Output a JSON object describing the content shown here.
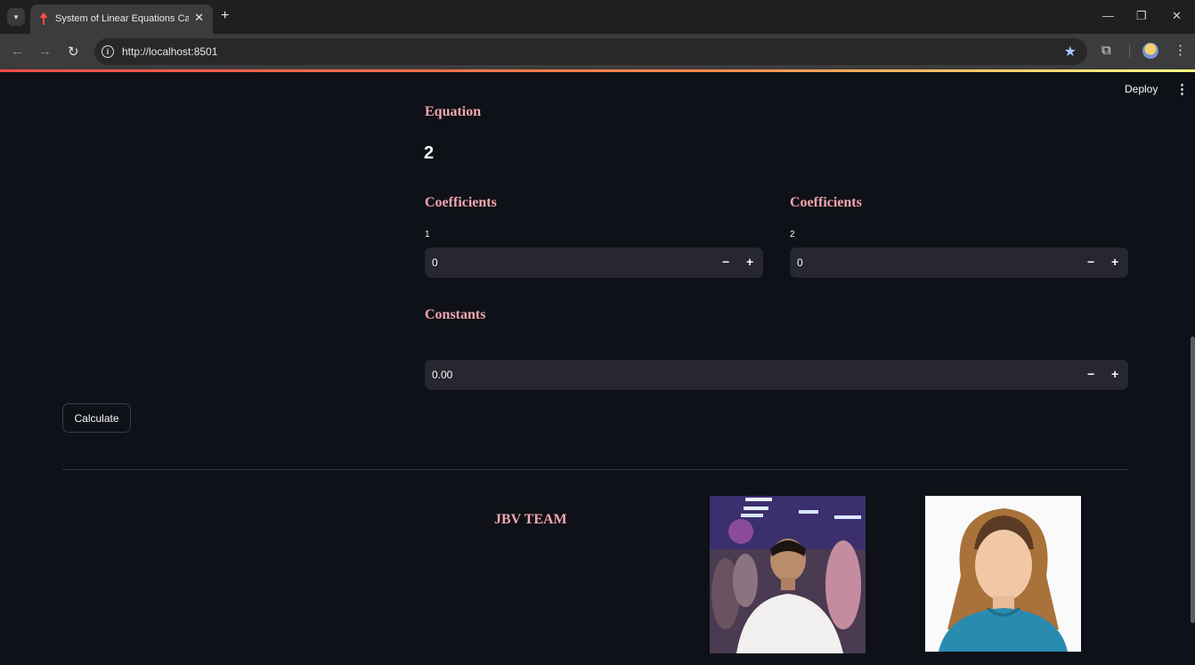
{
  "browser": {
    "tab_title": "System of Linear Equations Calc",
    "url": "http://localhost:8501"
  },
  "app": {
    "deploy_label": "Deploy",
    "equation_heading": "Equation",
    "equation_number": "2",
    "coefficients": [
      {
        "heading": "Coefficients",
        "label": "1",
        "value": "0"
      },
      {
        "heading": "Coefficients",
        "label": "2",
        "value": "0"
      }
    ],
    "constants_heading": "Constants",
    "constant_value": "0.00",
    "calculate_label": "Calculate",
    "team_heading": "JBV TEAM"
  },
  "icons": {
    "minus": "−",
    "plus": "+"
  }
}
